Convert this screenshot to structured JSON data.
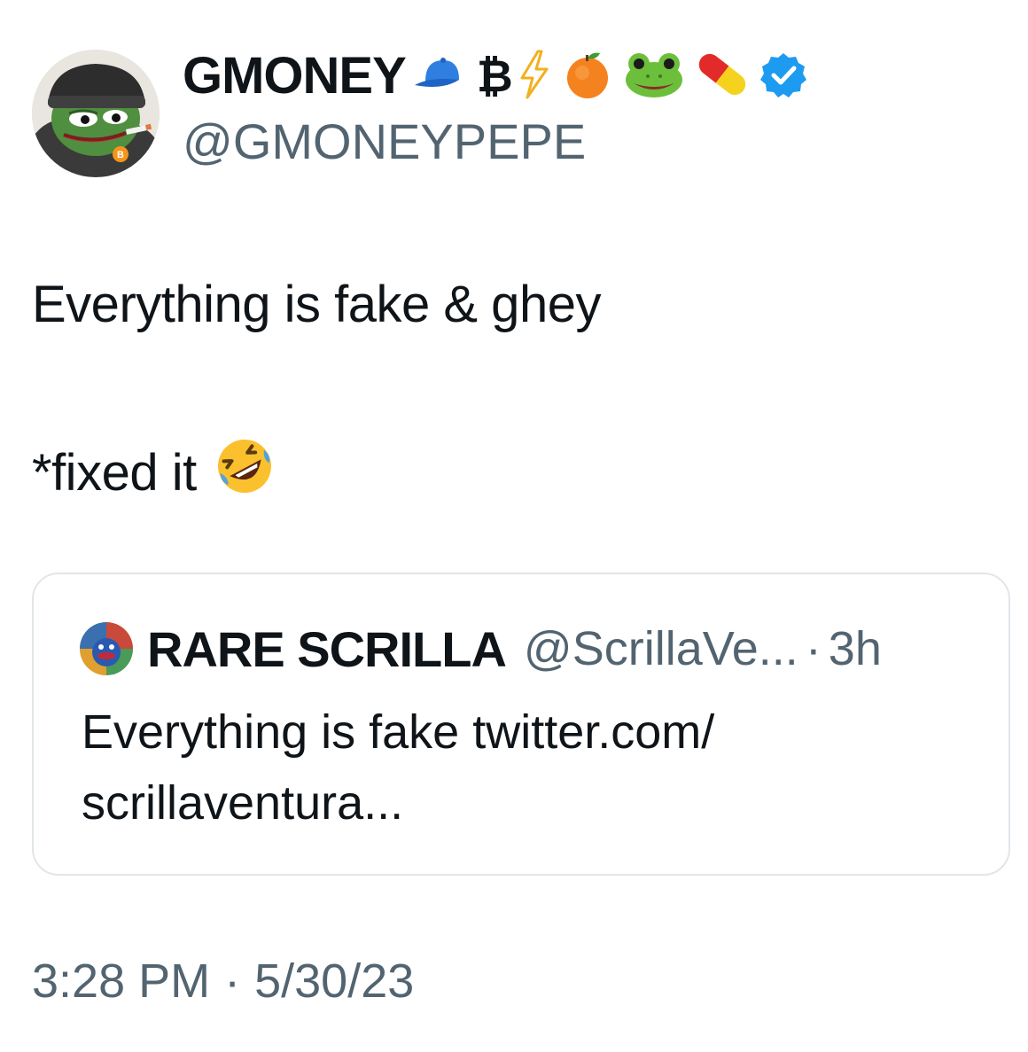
{
  "author": {
    "display_name": "GMONEY",
    "name_symbol": "₿",
    "name_icons": [
      "blue-cap-icon",
      "bitcoin-sign",
      "lightning-icon",
      "orange-icon",
      "frog-icon",
      "pill-icon",
      "verified-badge-icon"
    ],
    "handle": "@GMONEYPEPE"
  },
  "tweet": {
    "line1": "Everything is fake & ghey",
    "line2": "*fixed it",
    "line2_emoji": "rolling-on-floor-laughing-icon"
  },
  "quoted_tweet": {
    "display_name": "RARE SCRILLA",
    "handle": "@ScrillaVe...",
    "separator": "·",
    "time": "3h",
    "text_line1": "Everything is fake twitter.com/",
    "text_line2": "scrillaventura..."
  },
  "meta": {
    "time": "3:28 PM",
    "separator": "·",
    "date": "5/30/23"
  },
  "colors": {
    "text_primary": "#0f1419",
    "text_secondary": "#536471",
    "verified_blue": "#1d9bf0",
    "card_border": "#e1e6ea"
  }
}
